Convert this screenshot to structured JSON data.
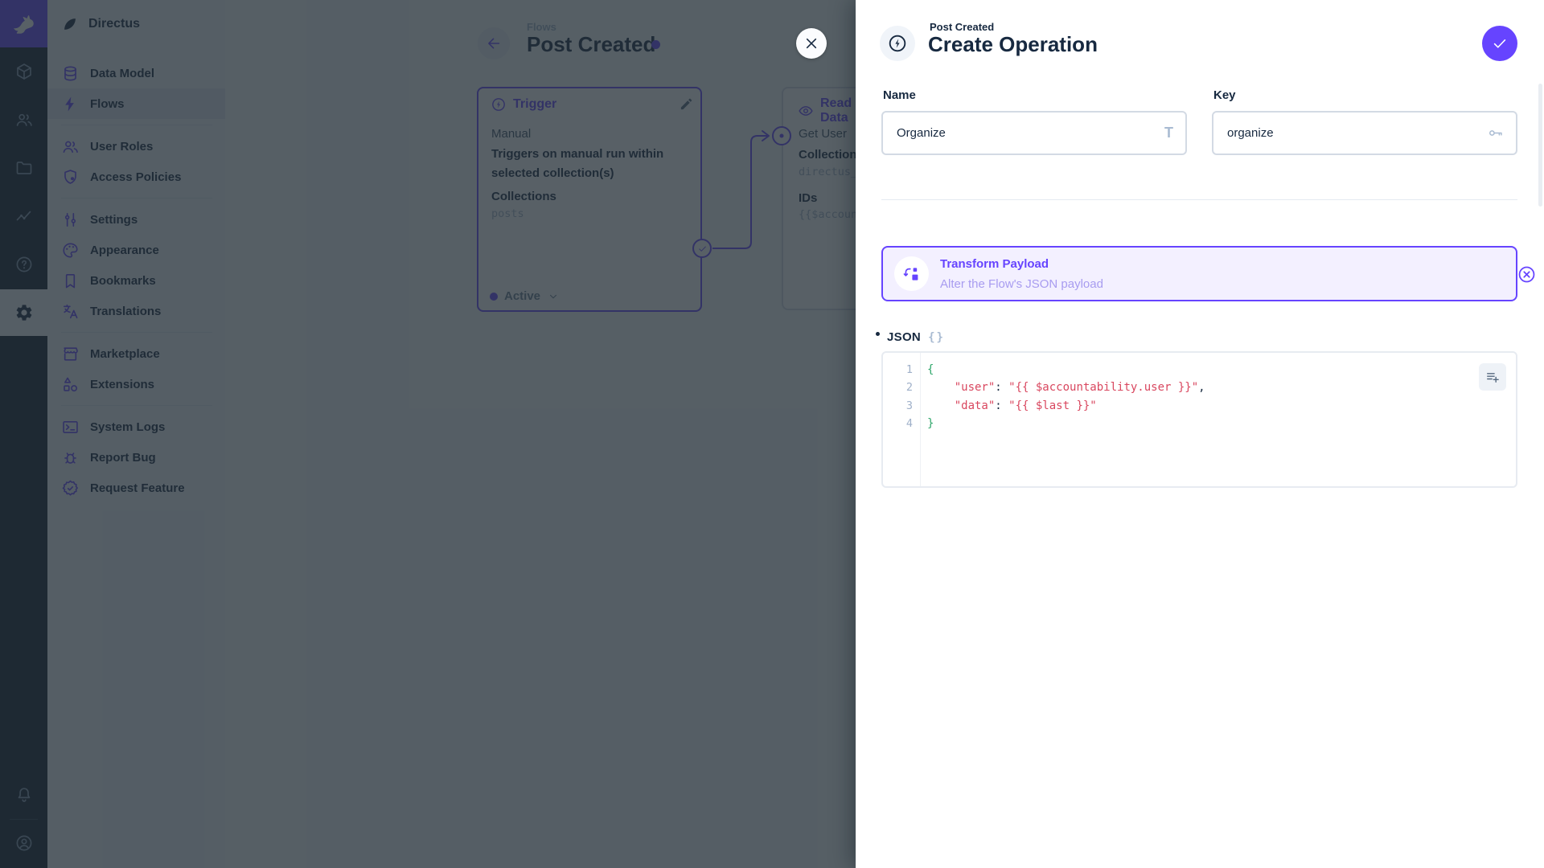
{
  "colors": {
    "primary": "#6644FF",
    "danger": "#E35169",
    "navy": "#172940",
    "code_string": "#D9475F",
    "code_bracket": "#2EA66A"
  },
  "module_bar": {
    "items": [
      {
        "icon": "cube",
        "name": "content"
      },
      {
        "icon": "users",
        "name": "users"
      },
      {
        "icon": "folder",
        "name": "files"
      },
      {
        "icon": "chart",
        "name": "insights"
      },
      {
        "icon": "help",
        "name": "help"
      },
      {
        "icon": "gear",
        "name": "settings",
        "active": true
      }
    ],
    "bottom": [
      {
        "icon": "bell",
        "name": "notifications"
      },
      {
        "icon": "account",
        "name": "user-menu"
      }
    ]
  },
  "sidebar": {
    "project": "Directus",
    "groups": [
      [
        {
          "icon": "database",
          "label": "Data Model"
        },
        {
          "icon": "bolt",
          "label": "Flows",
          "active": true
        }
      ],
      [
        {
          "icon": "users",
          "label": "User Roles"
        },
        {
          "icon": "shield",
          "label": "Access Policies"
        }
      ],
      [
        {
          "icon": "tune",
          "label": "Settings"
        },
        {
          "icon": "palette",
          "label": "Appearance"
        },
        {
          "icon": "bookmark",
          "label": "Bookmarks"
        },
        {
          "icon": "translate",
          "label": "Translations"
        }
      ],
      [
        {
          "icon": "storefront",
          "label": "Marketplace"
        },
        {
          "icon": "shapes",
          "label": "Extensions"
        }
      ],
      [
        {
          "icon": "terminal",
          "label": "System Logs"
        },
        {
          "icon": "bug",
          "label": "Report Bug"
        },
        {
          "icon": "seal-check",
          "label": "Request Feature"
        }
      ]
    ]
  },
  "canvas": {
    "breadcrumb": "Flows",
    "title": "Post Created",
    "trigger_card": {
      "header": "Trigger",
      "type_label": "Manual",
      "description": "Triggers on manual run within selected collection(s)",
      "field_label": "Collections",
      "field_value": "posts",
      "status_label": "Active"
    },
    "read_card": {
      "header": "Read Data",
      "name": "Get User",
      "field1_label": "Collection",
      "field1_value": "directus_users",
      "field2_label": "IDs",
      "field2_value": "{{$accountability.user}}"
    }
  },
  "drawer": {
    "breadcrumb": "Post Created",
    "title": "Create Operation",
    "name_field": {
      "label": "Name",
      "value": "Organize"
    },
    "key_field": {
      "label": "Key",
      "value": "organize"
    },
    "operation_type": {
      "title": "Transform Payload",
      "subtitle": "Alter the Flow's JSON payload"
    },
    "json_field": {
      "label": "JSON",
      "lines": [
        {
          "n": "1",
          "tokens": [
            {
              "t": "{",
              "c": "bracket"
            }
          ]
        },
        {
          "n": "2",
          "tokens": [
            {
              "t": "    ",
              "c": "plain"
            },
            {
              "t": "\"user\"",
              "c": "string"
            },
            {
              "t": ": ",
              "c": "plain"
            },
            {
              "t": "\"{{ $accountability.user }}\"",
              "c": "string"
            },
            {
              "t": ",",
              "c": "plain"
            }
          ]
        },
        {
          "n": "3",
          "tokens": [
            {
              "t": "    ",
              "c": "plain"
            },
            {
              "t": "\"data\"",
              "c": "string"
            },
            {
              "t": ": ",
              "c": "plain"
            },
            {
              "t": "\"{{ $last }}\"",
              "c": "string"
            }
          ]
        },
        {
          "n": "4",
          "tokens": [
            {
              "t": "}",
              "c": "bracket"
            }
          ]
        }
      ]
    }
  }
}
